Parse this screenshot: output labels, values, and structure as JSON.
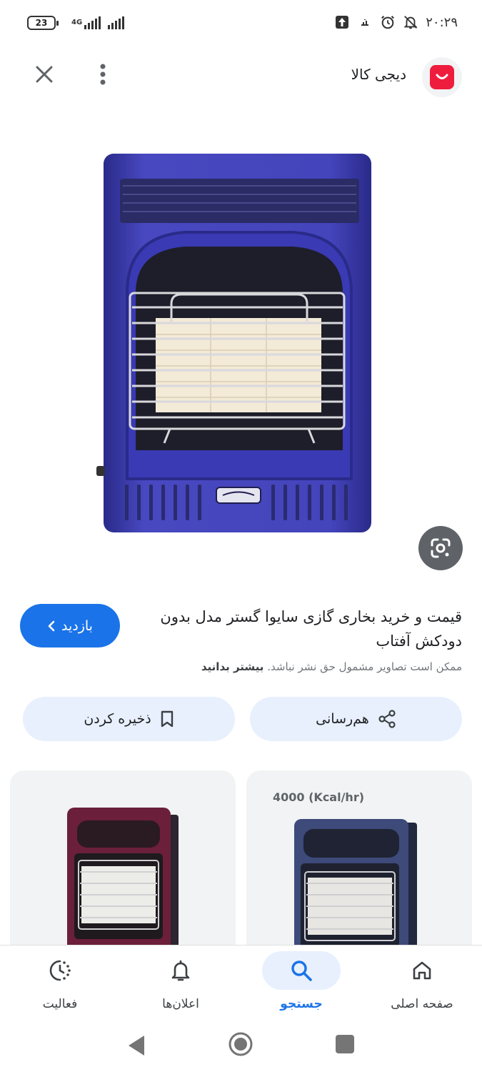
{
  "status_bar": {
    "battery": "23",
    "network": "4G",
    "time": "۲۰:۲۹"
  },
  "header": {
    "site_name": "دیجی کالا",
    "icons": [
      "close-icon",
      "more-vert-icon",
      "digikala-logo"
    ]
  },
  "result": {
    "title": "قیمت و خرید بخاری گازی سایوا گستر مدل بدون دودکش آفتاب",
    "disclaimer_text": "ممکن است تصاویر مشمول حق نشر نباشد.",
    "disclaimer_link": "بیشتر بدانید",
    "visit_label": "بازدید",
    "share_label": "هم‌رسانی",
    "save_label": "ذخیره کردن"
  },
  "related": [
    {
      "caption": "4000 (Kcal/hr)",
      "color": "#3d4a7a"
    },
    {
      "caption": "",
      "color": "#6b1f3a"
    }
  ],
  "bottom_nav": {
    "items": [
      {
        "label": "صفحه اصلی",
        "icon": "home-icon"
      },
      {
        "label": "جستجو",
        "icon": "search-icon",
        "active": true
      },
      {
        "label": "اعلان‌ها",
        "icon": "bell-icon"
      },
      {
        "label": "فعالیت",
        "icon": "activity-icon"
      }
    ]
  },
  "colors": {
    "accent": "#1a73e8",
    "chip_bg": "#e8f0fe",
    "heater_blue": "#3f3fb2",
    "brand_red": "#ee1d3e"
  }
}
